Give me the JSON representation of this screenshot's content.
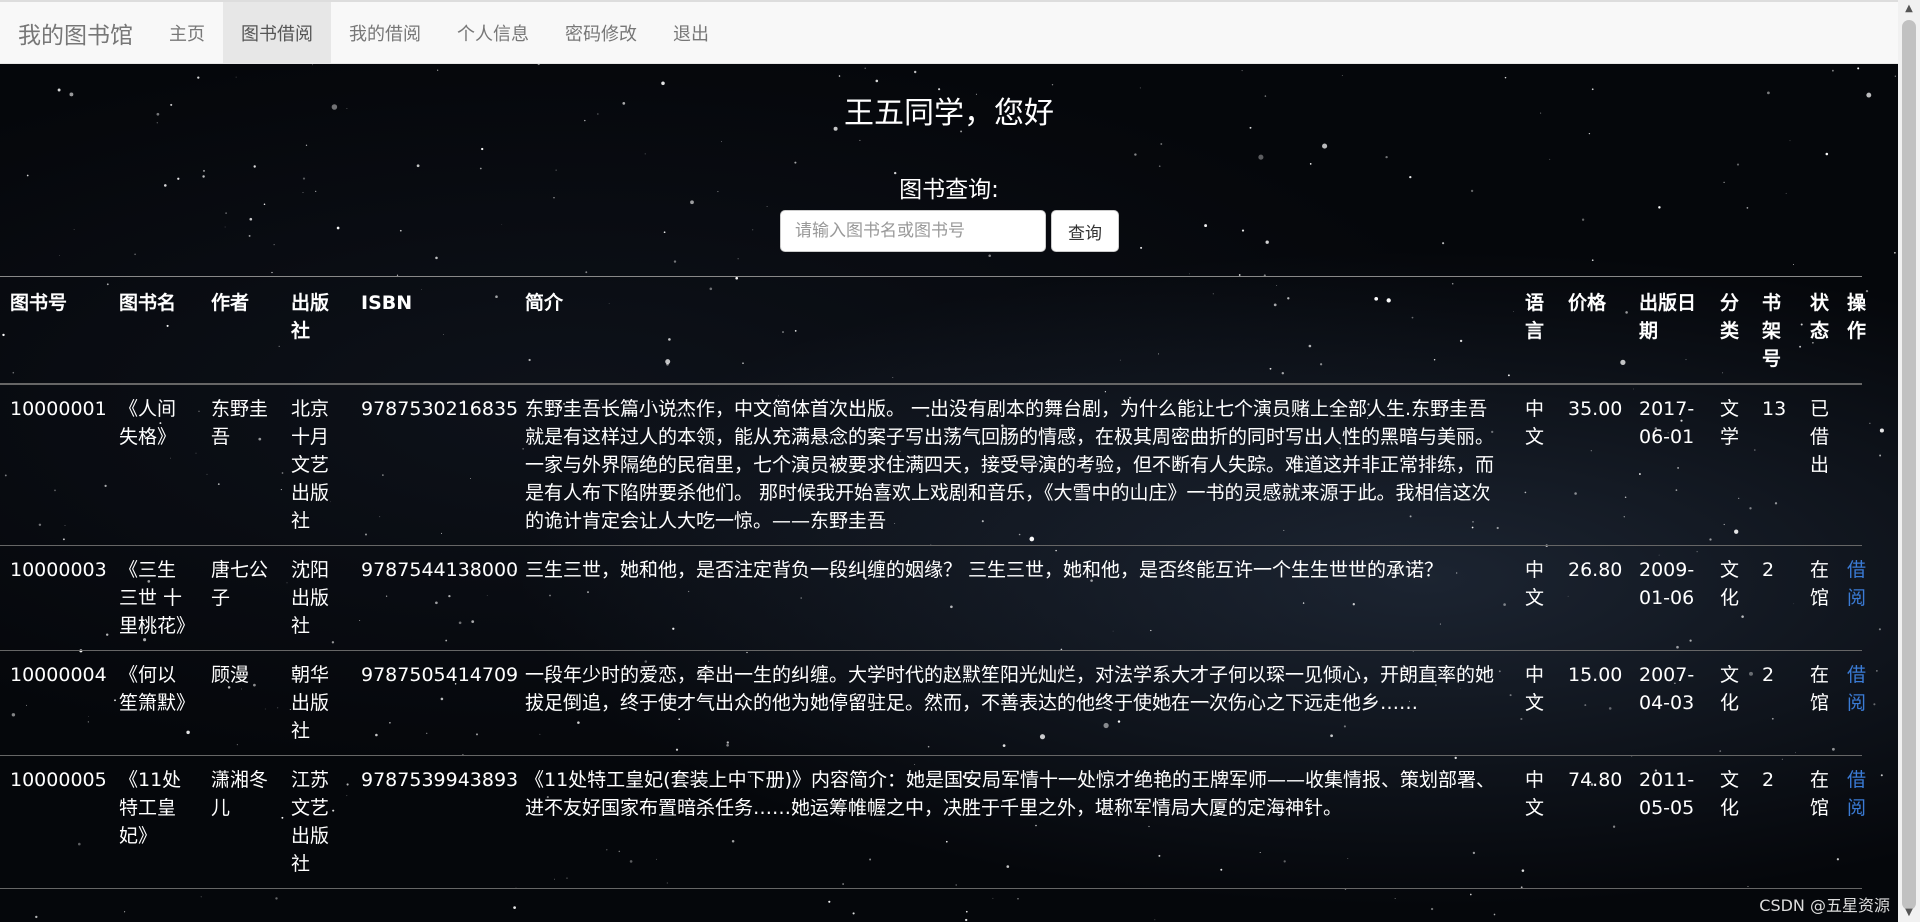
{
  "nav": {
    "brand": "我的图书馆",
    "items": [
      {
        "label": "主页",
        "active": false
      },
      {
        "label": "图书借阅",
        "active": true
      },
      {
        "label": "我的借阅",
        "active": false
      },
      {
        "label": "个人信息",
        "active": false
      },
      {
        "label": "密码修改",
        "active": false
      },
      {
        "label": "退出",
        "active": false
      }
    ]
  },
  "greeting": "王五同学，您好",
  "search": {
    "label": "图书查询:",
    "placeholder": "请输入图书名或图书号",
    "button": "查询"
  },
  "table": {
    "headers": [
      "图书号",
      "图书名",
      "作者",
      "出版社",
      "ISBN",
      "简介",
      "语言",
      "价格",
      "出版日期",
      "分类",
      "书架号",
      "状态",
      "操作"
    ],
    "rows": [
      [
        "10000001",
        "《人间失格》",
        "东野圭吾",
        "北京十月文艺出版社",
        "9787530216835",
        "东野圭吾长篇小说杰作，中文简体首次出版。 一出没有剧本的舞台剧，为什么能让七个演员赌上全部人生.东野圭吾就是有这样过人的本领，能从充满悬念的案子写出荡气回肠的情感，在极其周密曲折的同时写出人性的黑暗与美丽。 一家与外界隔绝的民宿里，七个演员被要求住满四天，接受导演的考验，但不断有人失踪。难道这并非正常排练，而是有人布下陷阱要杀他们。 那时候我开始喜欢上戏剧和音乐，《大雪中的山庄》一书的灵感就来源于此。我相信这次的诡计肯定会让人大吃一惊。——东野圭吾",
        "中文",
        "35.00",
        "2017-06-01",
        "文学",
        "13",
        "已借出",
        ""
      ],
      [
        "10000003",
        "《三生三世 十里桃花》",
        "唐七公子",
        "沈阳出版社",
        "9787544138000",
        "三生三世，她和他，是否注定背负一段纠缠的姻缘？ 三生三世，她和他，是否终能互许一个生生世世的承诺？",
        "中文",
        "26.80",
        "2009-01-06",
        "文化",
        "2",
        "在馆",
        "借阅"
      ],
      [
        "10000004",
        "《何以笙箫默》",
        "顾漫",
        "朝华出版社",
        "9787505414709",
        "一段年少时的爱恋，牵出一生的纠缠。大学时代的赵默笙阳光灿烂，对法学系大才子何以琛一见倾心，开朗直率的她拔足倒追，终于使才气出众的他为她停留驻足。然而，不善表达的他终于使她在一次伤心之下远走他乡……",
        "中文",
        "15.00",
        "2007-04-03",
        "文化",
        "2",
        "在馆",
        "借阅"
      ],
      [
        "10000005",
        "《11处特工皇妃》",
        "潇湘冬儿",
        "江苏文艺出版社",
        "9787539943893",
        "《11处特工皇妃(套装上中下册)》内容简介：她是国安局军情十一处惊才绝艳的王牌军师——收集情报、策划部署、进不友好国家布置暗杀任务……她运筹帷幄之中，决胜于千里之外，堪称军情局大厦的定海神针。",
        "中文",
        "74.80",
        "2011-05-05",
        "文化",
        "2",
        "在馆",
        "借阅"
      ]
    ]
  },
  "watermark": "CSDN @五星资源"
}
